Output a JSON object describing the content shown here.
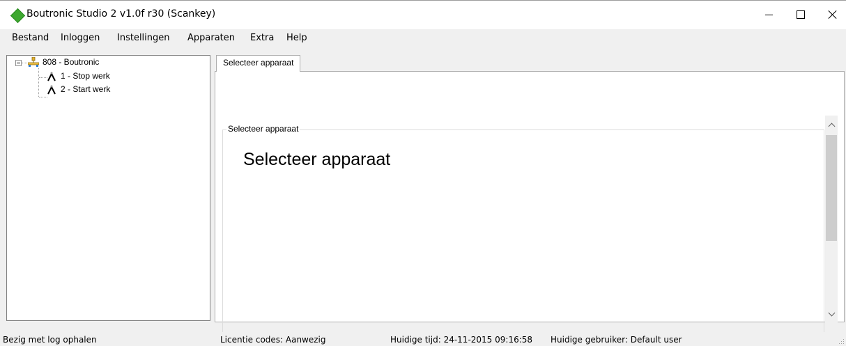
{
  "window": {
    "title": "Boutronic Studio 2 v1.0f r30 (Scankey)",
    "icon": "green-diamond-icon",
    "accent_color": "#3ea830"
  },
  "menu": {
    "items": [
      {
        "label": "Bestand"
      },
      {
        "label": "Inloggen"
      },
      {
        "label": "Instellingen"
      },
      {
        "label": "Apparaten"
      },
      {
        "label": "Extra"
      },
      {
        "label": "Help"
      }
    ]
  },
  "tree": {
    "root": {
      "label": "808 - Boutronic",
      "icon": "network-icon",
      "expanded": true
    },
    "children": [
      {
        "label": "1 - Stop werk",
        "icon": "device-icon"
      },
      {
        "label": "2 - Start werk",
        "icon": "device-icon"
      }
    ]
  },
  "tabs": [
    {
      "label": "Selecteer apparaat",
      "selected": true
    }
  ],
  "content": {
    "group_label": "Selecteer apparaat",
    "heading": "Selecteer apparaat"
  },
  "status": {
    "message": "Bezig met log ophalen",
    "license": "Licentie codes: Aanwezig",
    "time": "Huidige tijd: 24-11-2015 09:16:58",
    "user": "Huidige gebruiker: Default user"
  }
}
